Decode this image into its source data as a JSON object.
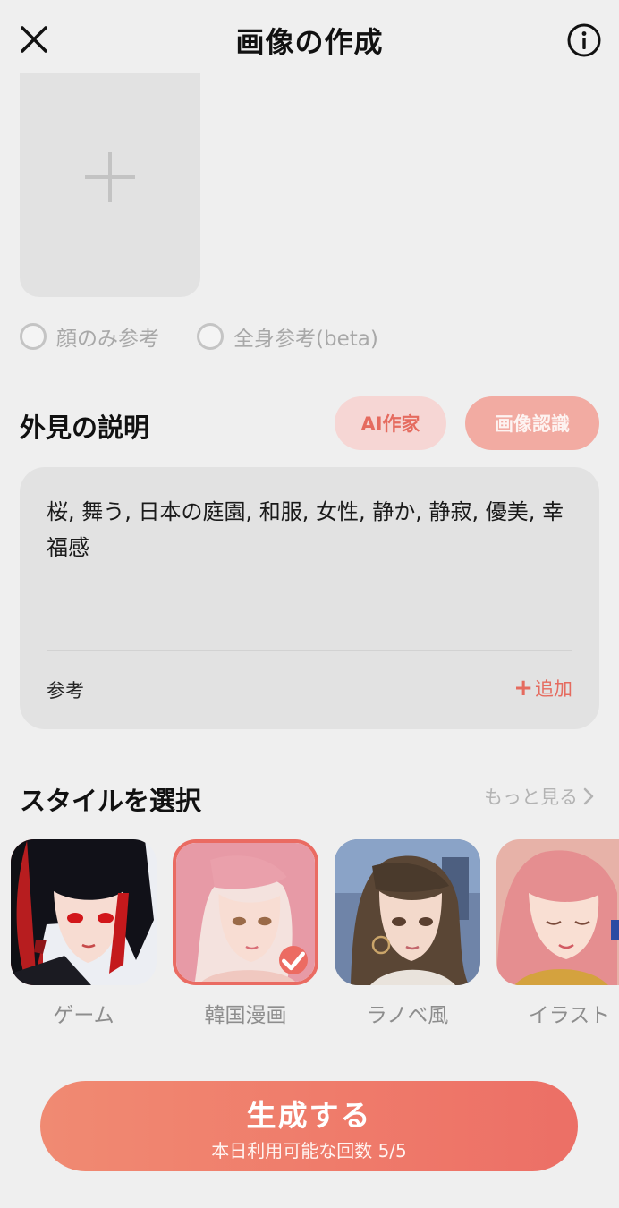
{
  "header": {
    "title": "画像の作成",
    "close_icon": "close-icon",
    "info_icon": "info-icon"
  },
  "upload": {
    "icon": "plus-icon"
  },
  "reference_options": [
    {
      "label": "顔のみ参考",
      "selected": false
    },
    {
      "label": "全身参考(beta)",
      "selected": false
    }
  ],
  "appearance": {
    "title": "外見の説明",
    "ai_writer_label": "AI作家",
    "image_recognition_label": "画像認識",
    "description": "桜, 舞う, 日本の庭園, 和服, 女性, 静か, 静寂, 優美, 幸福感",
    "reference_label": "参考",
    "add_label": "追加"
  },
  "style": {
    "title": "スタイルを選択",
    "more_label": "もっと見る",
    "items": [
      {
        "label": "ゲーム",
        "selected": false
      },
      {
        "label": "韓国漫画",
        "selected": true
      },
      {
        "label": "ラノベ風",
        "selected": false
      },
      {
        "label": "イラスト",
        "selected": false
      }
    ]
  },
  "generate": {
    "label": "生成する",
    "sub_label": "本日利用可能な回数 5/5"
  },
  "colors": {
    "accent": "#ec6b62",
    "background": "#efefef",
    "panel": "#e2e2e2"
  }
}
